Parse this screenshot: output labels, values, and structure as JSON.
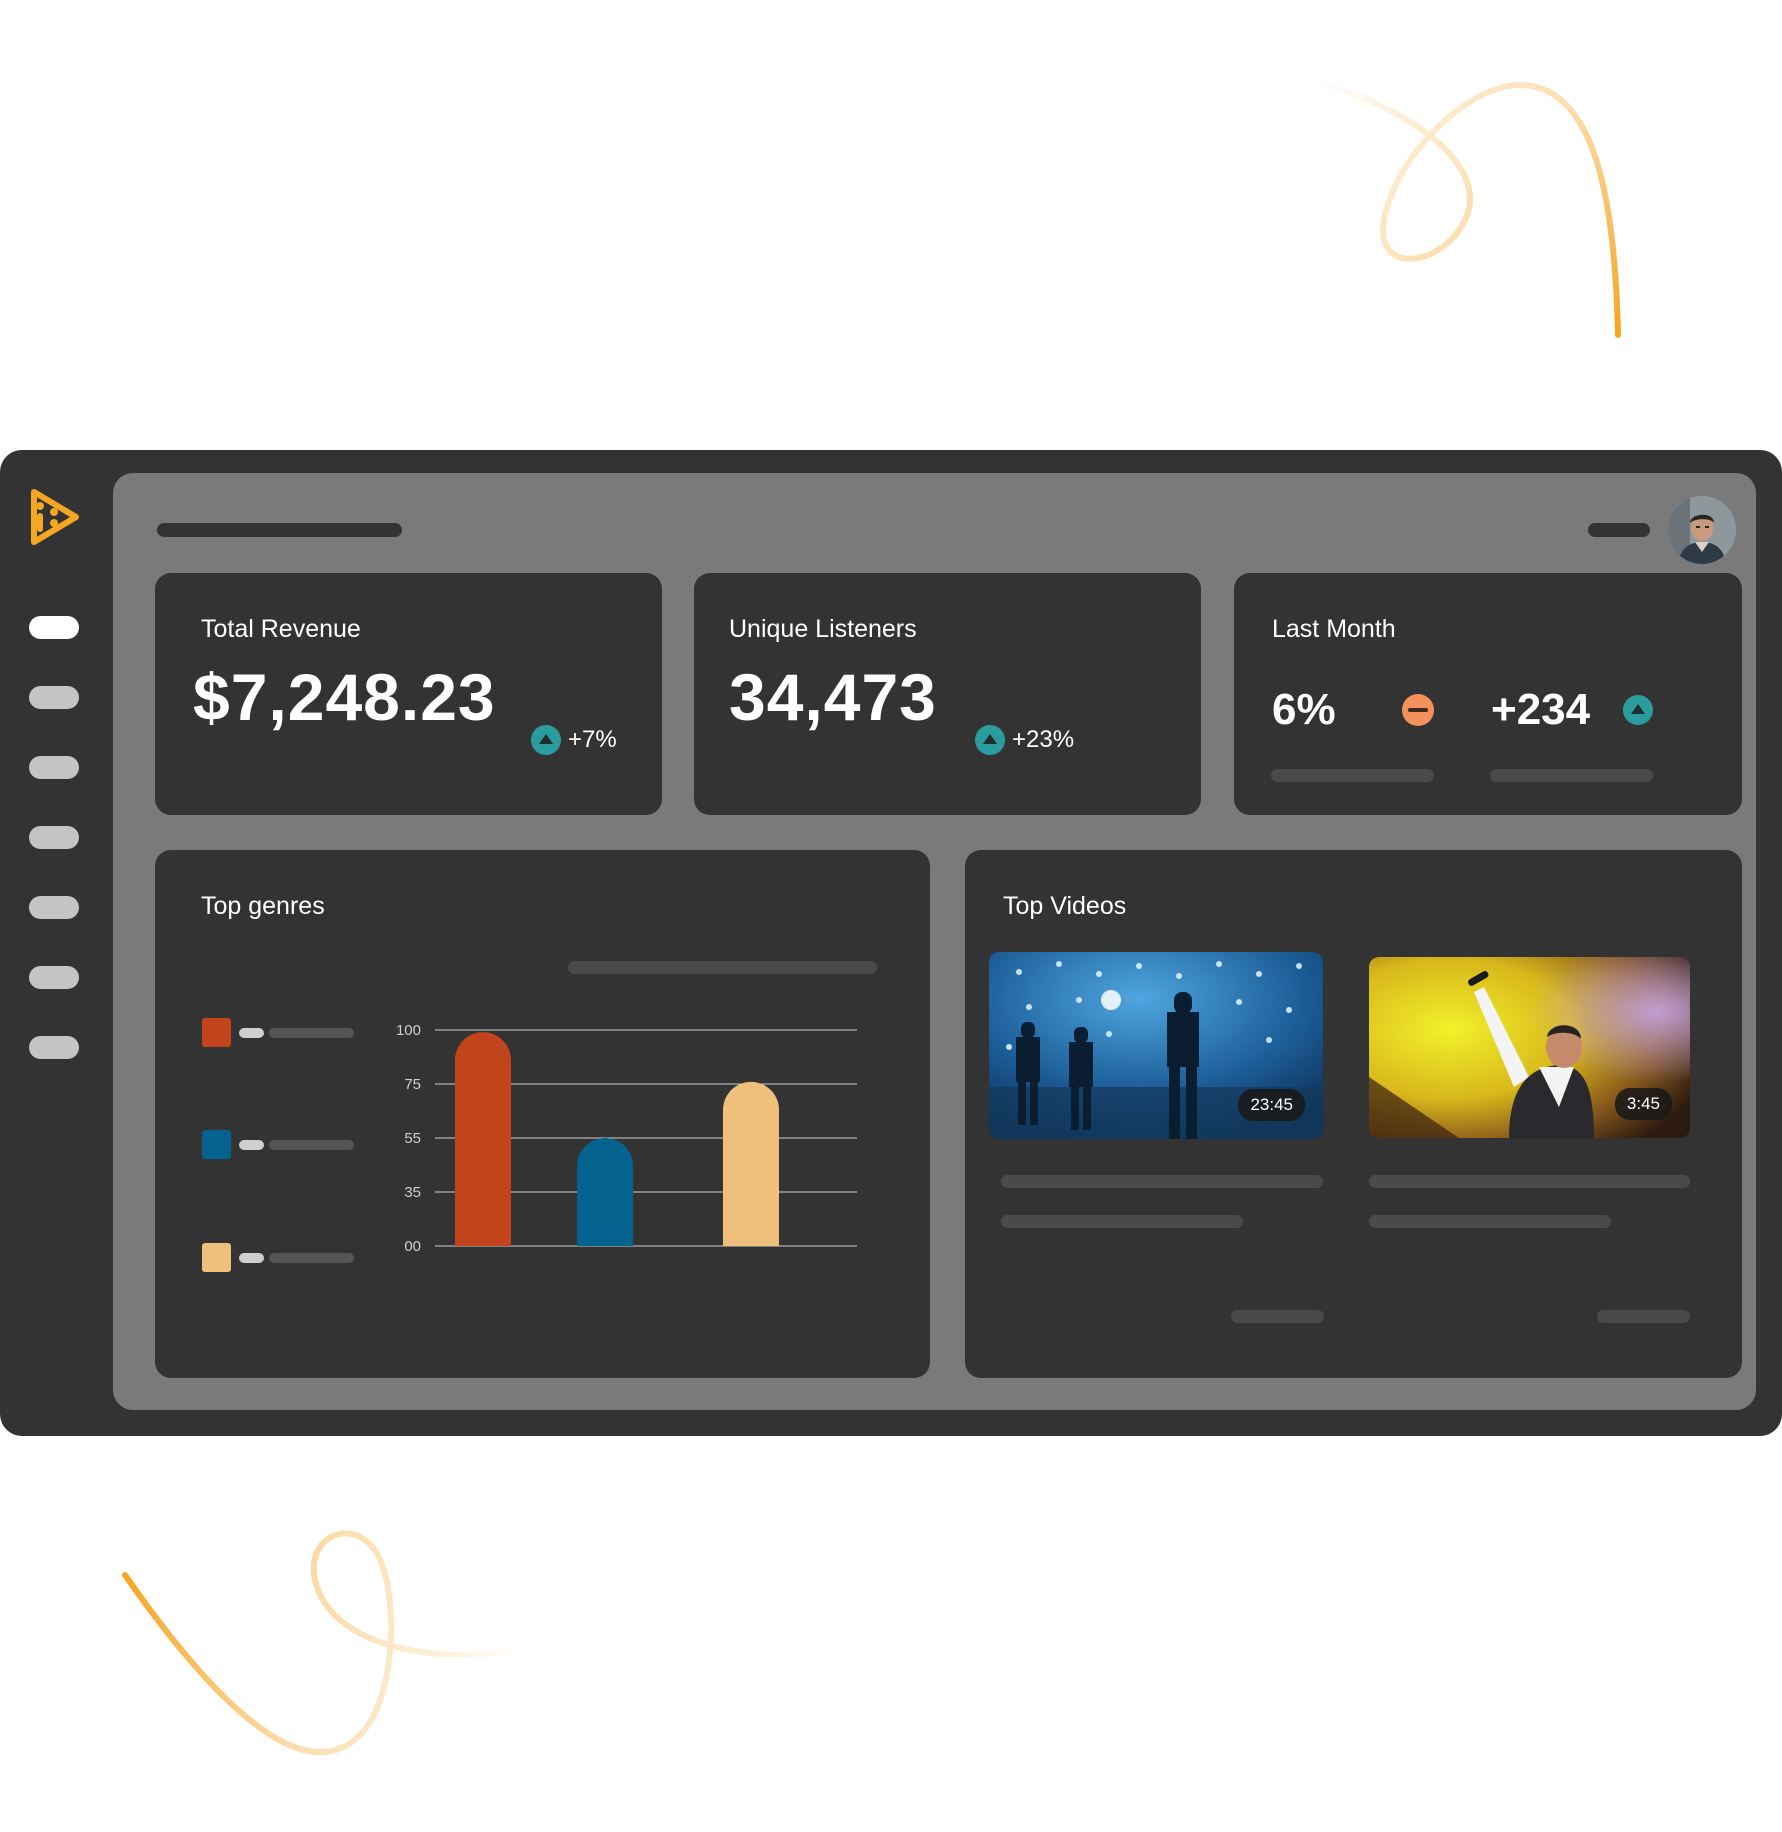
{
  "stats": {
    "revenue": {
      "title": "Total Revenue",
      "value": "$7,248.23",
      "delta": "+7%"
    },
    "listeners": {
      "title": "Unique Listeners",
      "value": "34,473",
      "delta": "+23%"
    },
    "last_month": {
      "title": "Last Month",
      "percent": "6%",
      "count": "+234"
    }
  },
  "genres": {
    "title": "Top genres"
  },
  "videos": {
    "title": "Top Videos",
    "items": [
      {
        "duration": "23:45"
      },
      {
        "duration": "3:45"
      }
    ]
  },
  "colors": {
    "accent": "#f5a623",
    "up": "#2a9c9d",
    "down": "#f4915c"
  },
  "chart_data": {
    "type": "bar",
    "categories": [
      "",
      "",
      ""
    ],
    "values": [
      99,
      50,
      76
    ],
    "colors": [
      "#c1441c",
      "#04628f",
      "#eec07b"
    ],
    "y_tick_labels": [
      "00",
      "35",
      "55",
      "75",
      "100"
    ],
    "y_tick_values": [
      0,
      25,
      50,
      75,
      100
    ],
    "ylim": [
      0,
      100
    ],
    "grid": true,
    "legend": "left"
  }
}
